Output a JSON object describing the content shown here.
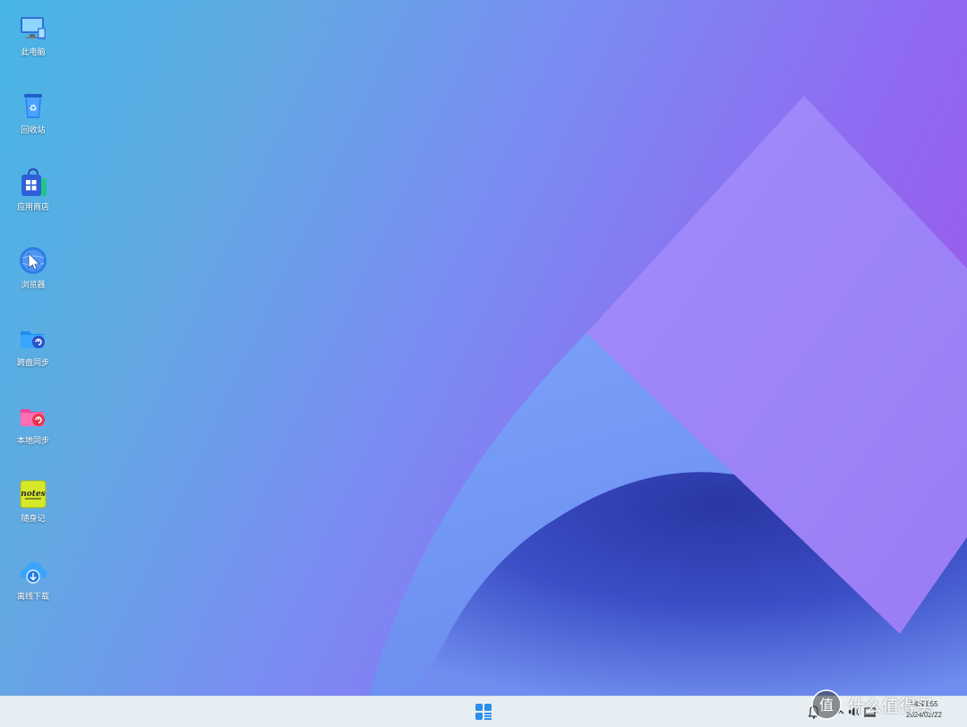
{
  "desktop": {
    "icons": [
      {
        "label": "此电脑",
        "icon": "computer-icon"
      },
      {
        "label": "回收站",
        "icon": "recycle-bin-icon"
      },
      {
        "label": "应用商店",
        "icon": "app-store-icon"
      },
      {
        "label": "浏览器",
        "icon": "browser-icon"
      },
      {
        "label": "跨盘同步",
        "icon": "cross-disk-sync-icon"
      },
      {
        "label": "本地同步",
        "icon": "local-sync-icon"
      },
      {
        "label": "随身记",
        "icon": "notes-icon"
      },
      {
        "label": "离线下载",
        "icon": "offline-download-icon"
      }
    ],
    "notes_icon_text": "notes"
  },
  "taskbar": {
    "start_icon": "start-menu-icon",
    "tray_icons": [
      "notification-bell-icon",
      "chevron-up-icon",
      "volume-icon",
      "network-icon"
    ],
    "clock_time": "14:43:55",
    "clock_date": "2024/02/22"
  },
  "watermark": {
    "text": "什么值得买",
    "logo_text": "值"
  },
  "colors": {
    "wallpaper_left": "#47b6e6",
    "wallpaper_right": "#a04fe6",
    "taskbar": "#e6eef3",
    "start_blue": "#2b8fe8"
  }
}
